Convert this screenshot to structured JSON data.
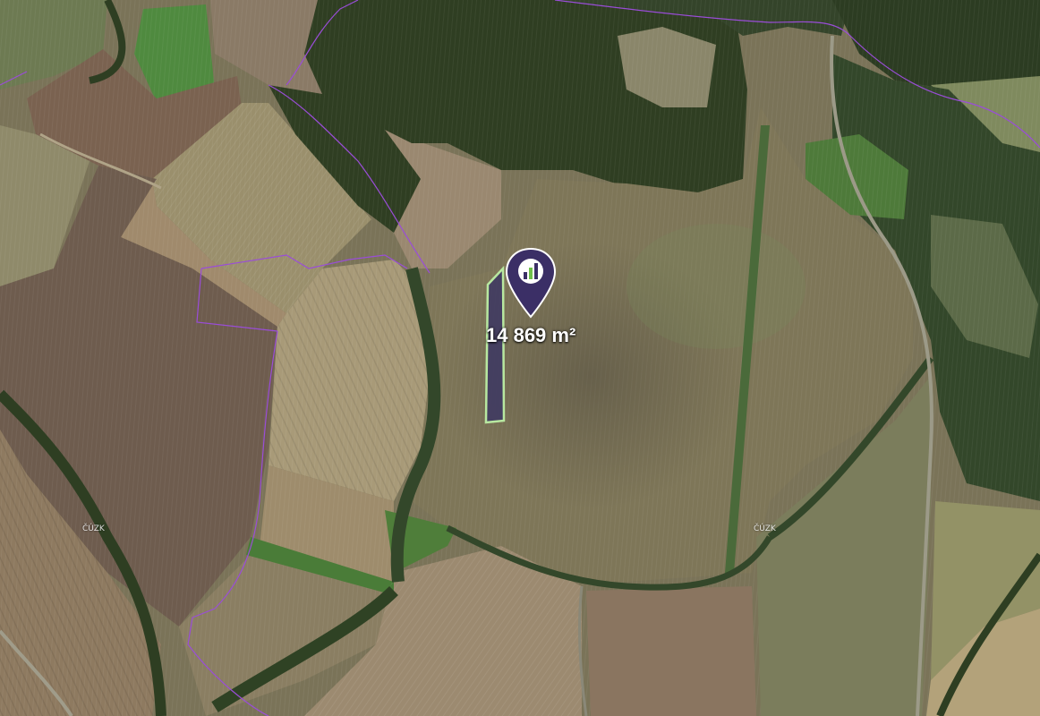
{
  "map": {
    "type": "satellite",
    "parcel_area_label": "14 869 m²",
    "marker_icon": "map-pin-logo-icon",
    "watermarks": [
      "ČÚZK",
      "ČÚZK"
    ],
    "colors": {
      "parcel_fill": "#3f3a62",
      "parcel_outline": "#b8e8a0",
      "marker": "#3b2f66",
      "boundary_lines": "#9a4dd8"
    }
  }
}
